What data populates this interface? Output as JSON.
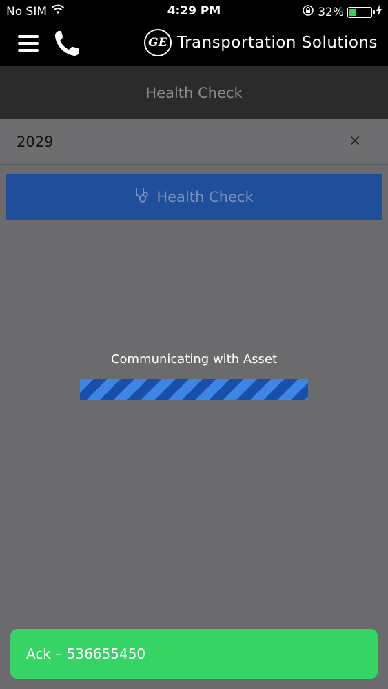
{
  "status_bar": {
    "carrier": "No SIM",
    "time": "4:29 PM",
    "battery_percent": "32%",
    "battery_level": 0.32
  },
  "header": {
    "brand_logo": "GE",
    "brand_name": "Transportation Solutions"
  },
  "title_bar": {
    "title": "Health Check"
  },
  "asset_search": {
    "value": "2029",
    "clear_glyph": "×"
  },
  "health_check_button": {
    "label": "Health Check",
    "icon": "stethoscope-icon"
  },
  "progress": {
    "label": "Communicating with Asset",
    "value": 1.0
  },
  "toast": {
    "message": "Ack – 536655450"
  },
  "colors": {
    "accent_blue": "#1f4f9a",
    "progress_blue": "#3d86e6",
    "toast_green": "#35d465",
    "overlay_gray": "#6b6b6d"
  }
}
